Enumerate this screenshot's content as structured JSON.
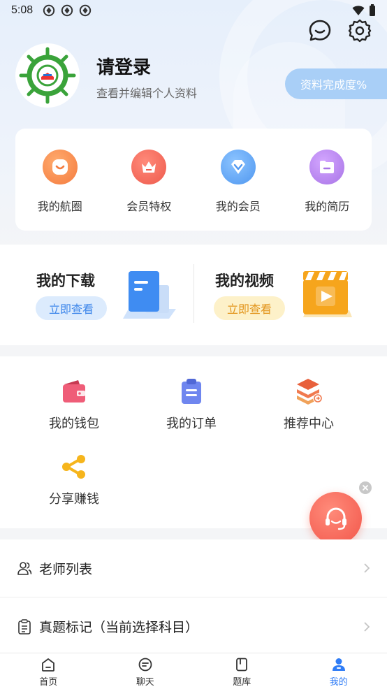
{
  "status_bar": {
    "time": "5:08"
  },
  "profile": {
    "title": "请登录",
    "subtitle": "查看并编辑个人资料",
    "completion_label": "资料完成度%"
  },
  "quick_menu": [
    {
      "label": "我的航圈",
      "icon": "smile-icon",
      "color": "#f7894a"
    },
    {
      "label": "会员特权",
      "icon": "crown-icon",
      "color": "#f0685a"
    },
    {
      "label": "我的会员",
      "icon": "diamond-icon",
      "color": "#5aa6f5"
    },
    {
      "label": "我的简历",
      "icon": "folder-icon",
      "color": "#b47ee8"
    }
  ],
  "downloads": {
    "title": "我的下载",
    "button": "立即查看"
  },
  "videos": {
    "title": "我的视频",
    "button": "立即查看"
  },
  "services": [
    {
      "label": "我的钱包",
      "icon": "wallet-icon"
    },
    {
      "label": "我的订单",
      "icon": "clipboard-icon"
    },
    {
      "label": "推荐中心",
      "icon": "layers-icon"
    },
    {
      "label": "分享赚钱",
      "icon": "share-icon"
    }
  ],
  "list": [
    {
      "label": "老师列表",
      "icon": "users-icon"
    },
    {
      "label": "真题标记（当前选择科目）",
      "icon": "document-icon"
    }
  ],
  "bottom_nav": [
    {
      "label": "首页",
      "icon": "home-icon",
      "active": false
    },
    {
      "label": "聊天",
      "icon": "chat-icon",
      "active": false
    },
    {
      "label": "题库",
      "icon": "book-icon",
      "active": false
    },
    {
      "label": "我的",
      "icon": "user-icon",
      "active": true
    }
  ],
  "colors": {
    "accent": "#2f7cf6",
    "completion_pill": "#a9cff7",
    "help_button": "#f2564a"
  }
}
